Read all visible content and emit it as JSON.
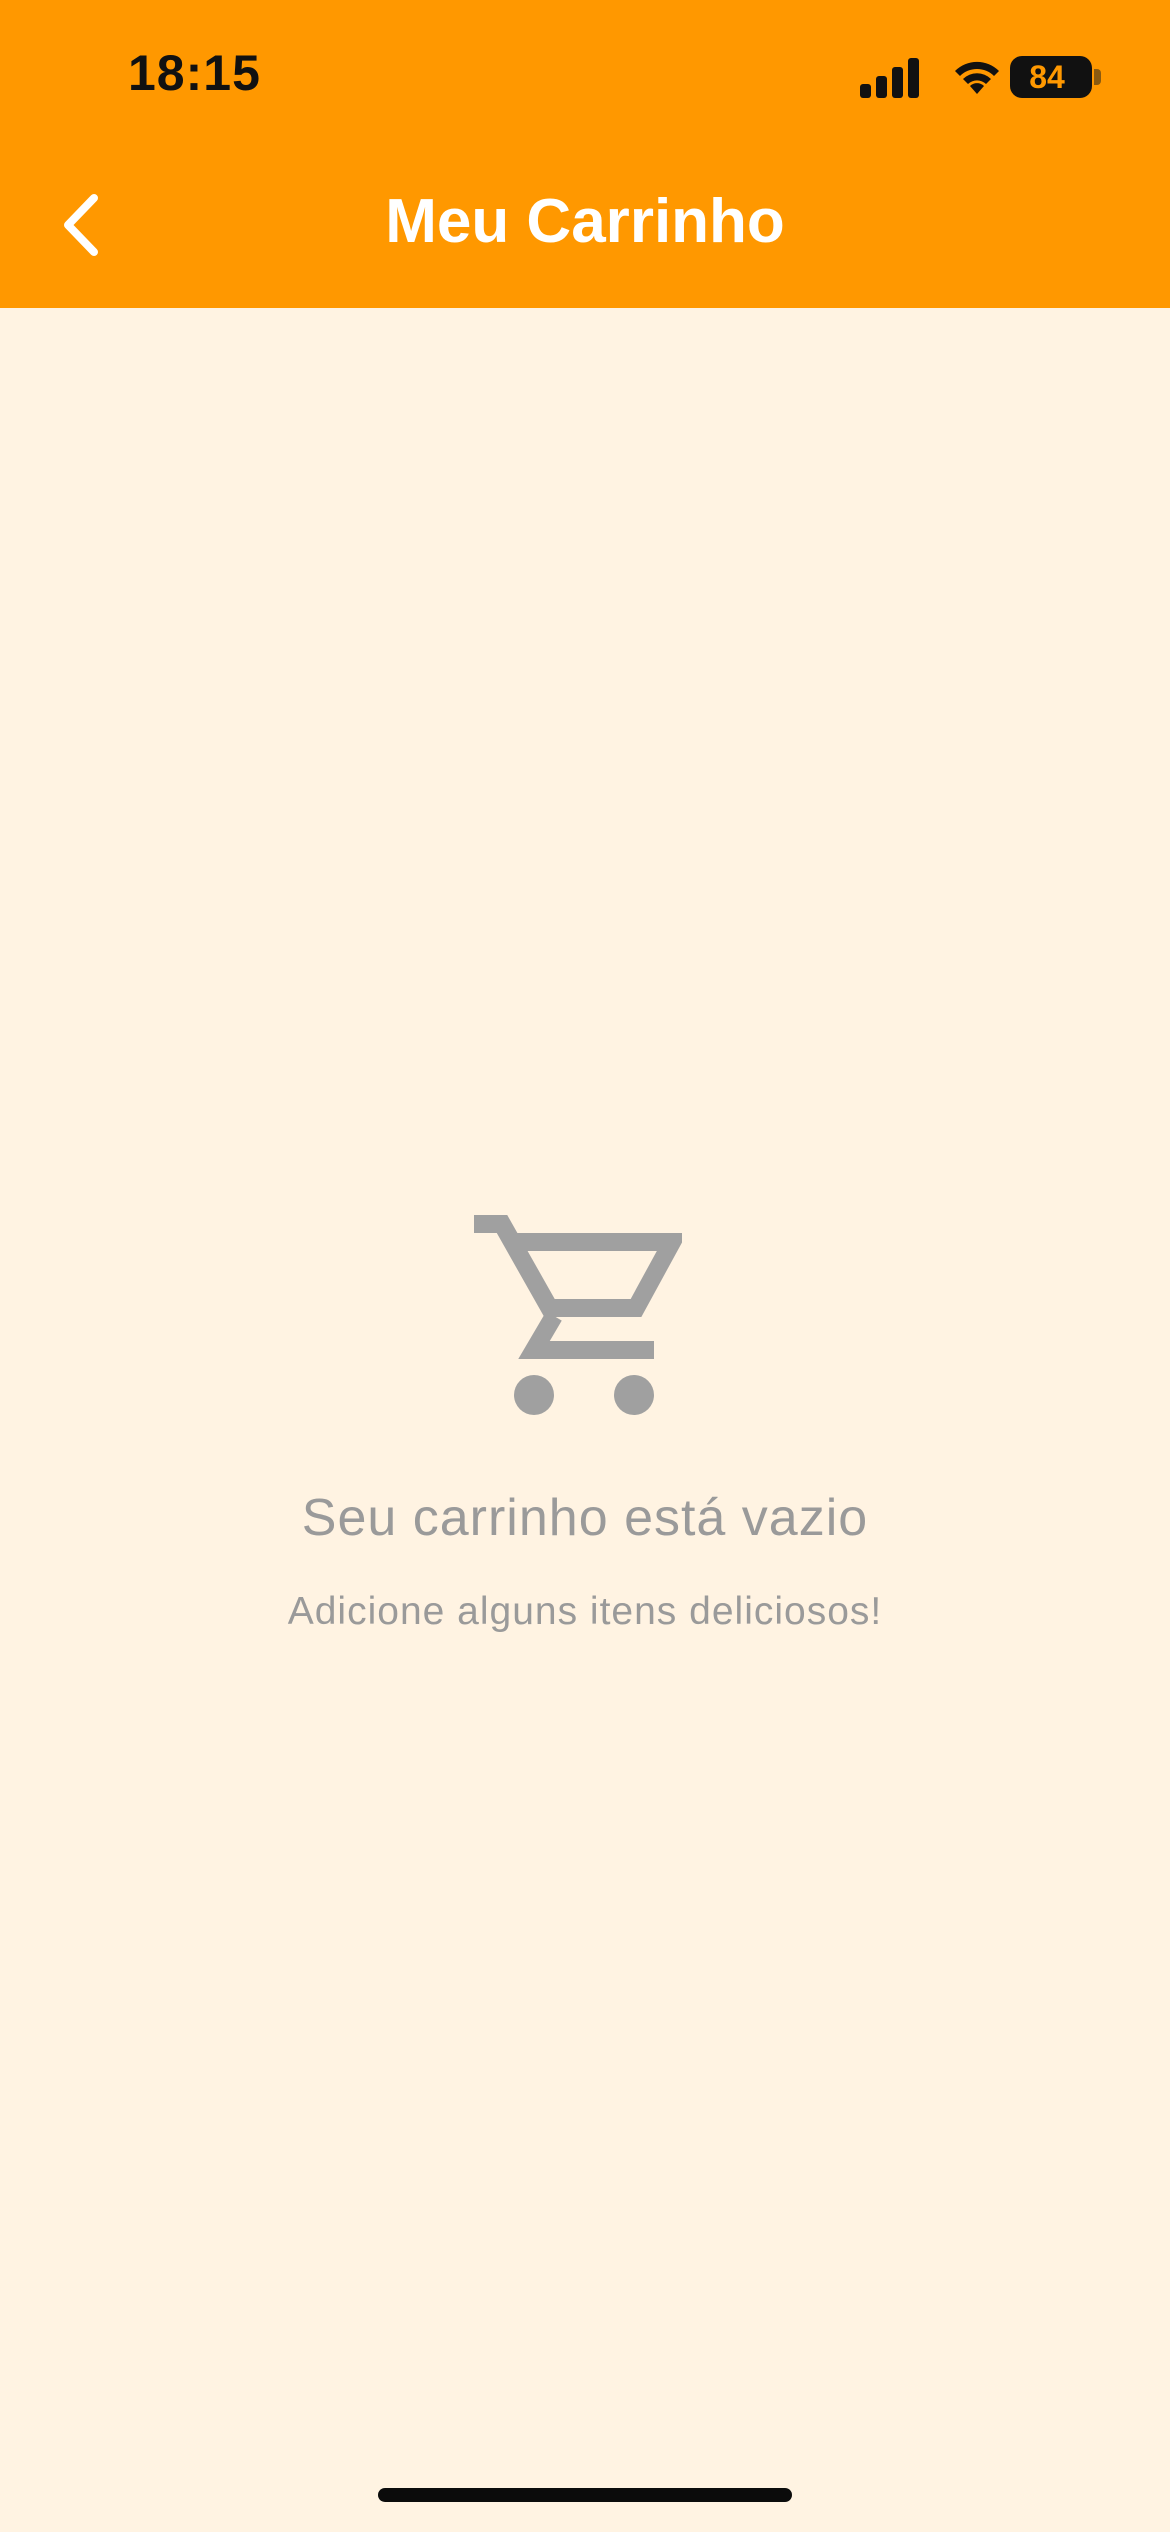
{
  "status_bar": {
    "time": "18:15",
    "battery_level": "84",
    "signal_icon": "cellular-signal-icon",
    "wifi_icon": "wifi-icon"
  },
  "header": {
    "title": "Meu Carrinho",
    "back_icon": "chevron-left-icon",
    "background_color": "#FF9800"
  },
  "empty_state": {
    "icon": "shopping-cart-icon",
    "title": "Seu carrinho está vazio",
    "subtitle": "Adicione alguns itens deliciosos!",
    "icon_color": "#A0A0A0"
  },
  "colors": {
    "page_background": "#FFF3E2",
    "text_muted": "#9A9A9A"
  }
}
